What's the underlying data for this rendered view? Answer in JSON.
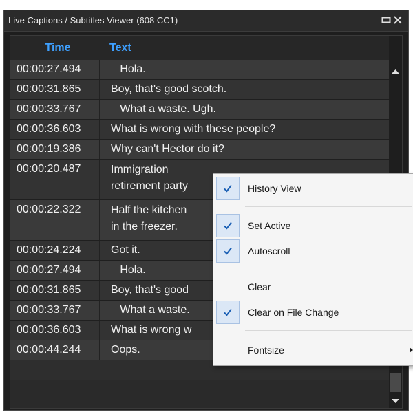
{
  "window": {
    "title": "Live Captions / Subtitles Viewer (608 CC1)"
  },
  "table": {
    "headers": {
      "time": "Time",
      "text": "Text"
    },
    "rows": [
      {
        "time": "00:00:27.494",
        "text": [
          "   Hola."
        ]
      },
      {
        "time": "00:00:31.865",
        "text": [
          "Boy, that's good scotch."
        ]
      },
      {
        "time": "00:00:33.767",
        "text": [
          "   What a waste. Ugh."
        ]
      },
      {
        "time": "00:00:36.603",
        "text": [
          "What is wrong with these people?"
        ]
      },
      {
        "time": "00:00:19.386",
        "text": [
          "Why can't Hector do it?"
        ]
      },
      {
        "time": "00:00:20.487",
        "text": [
          "Immigration",
          "retirement party"
        ]
      },
      {
        "time": "00:00:22.322",
        "text": [
          "Half the kitchen",
          "in the freezer."
        ]
      },
      {
        "time": "00:00:24.224",
        "text": [
          "Got it."
        ]
      },
      {
        "time": "00:00:27.494",
        "text": [
          "   Hola."
        ]
      },
      {
        "time": "00:00:31.865",
        "text": [
          "Boy, that's good"
        ]
      },
      {
        "time": "00:00:33.767",
        "text": [
          "   What a waste."
        ]
      },
      {
        "time": "00:00:36.603",
        "text": [
          "What is wrong w"
        ]
      },
      {
        "time": "00:00:44.244",
        "text": [
          "Oops."
        ]
      }
    ]
  },
  "context_menu": {
    "items": [
      {
        "label": "History View",
        "checked": true
      },
      {
        "label": "Set Active",
        "checked": true
      },
      {
        "label": "Autoscroll",
        "checked": true
      },
      {
        "label": "Clear",
        "checked": false
      },
      {
        "label": "Clear on File Change",
        "checked": true
      },
      {
        "label": "Fontsize",
        "checked": false,
        "submenu": true
      }
    ]
  },
  "icons": {
    "maximize": "maximize-icon",
    "close": "close-icon",
    "check": "checkmark-icon",
    "scroll_up": "scroll-up-arrow-icon",
    "scroll_down": "scroll-down-arrow-icon",
    "submenu": "submenu-arrow-icon"
  },
  "colors": {
    "header_text": "#3ea0ff",
    "check_color": "#1a5fb4"
  }
}
